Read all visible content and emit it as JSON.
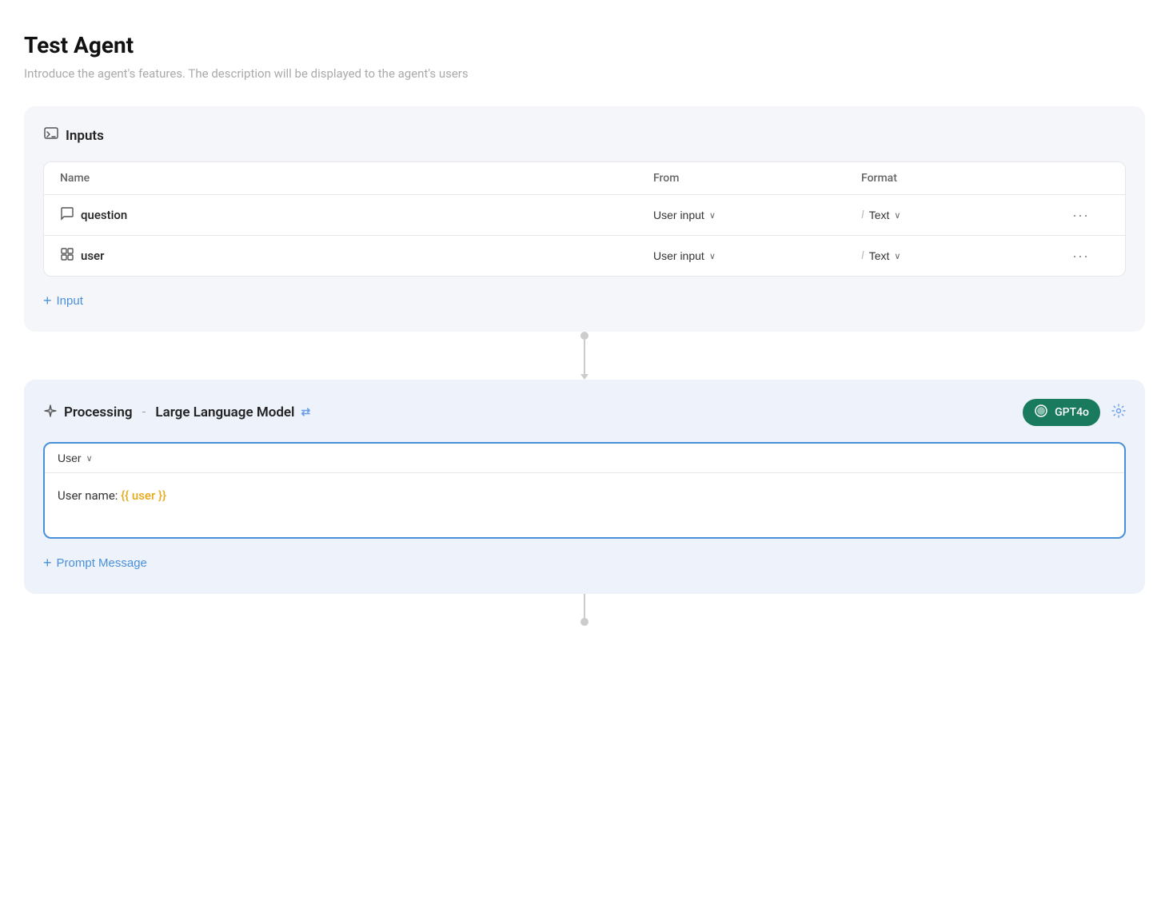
{
  "page": {
    "title": "Test Agent",
    "subtitle": "Introduce the agent's features. The description will be displayed to the agent's users"
  },
  "inputs_section": {
    "title": "Inputs",
    "icon": "📋",
    "table": {
      "headers": [
        "Name",
        "From",
        "Format"
      ],
      "rows": [
        {
          "id": "question",
          "icon": "💬",
          "name": "question",
          "from": "User input",
          "format": "Text"
        },
        {
          "id": "user",
          "icon": "🔗",
          "name": "user",
          "from": "User input",
          "format": "Text"
        }
      ]
    },
    "add_button": "Input"
  },
  "processing_section": {
    "title": "Processing",
    "subtitle": "Large Language Model",
    "model": "GPT4o",
    "swap_icon": "⇄",
    "settings_icon": "⚙",
    "message": {
      "role": "User",
      "content_prefix": "User name: ",
      "template_var": "{{ user }}"
    },
    "add_prompt_label": "Prompt Message"
  },
  "icons": {
    "inputs": "⬛",
    "processing": "✦",
    "swap": "⇄",
    "chevron_down": "∨",
    "plus": "+",
    "more": "•••",
    "text_cursor": "I"
  }
}
